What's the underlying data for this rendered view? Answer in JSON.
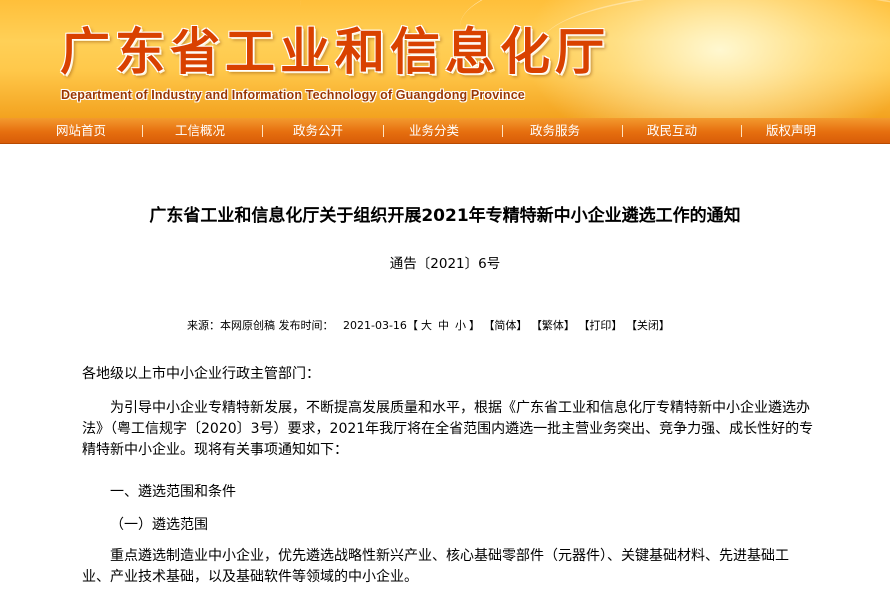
{
  "header": {
    "title_cn": "广东省工业和信息化厅",
    "title_en": "Department of Industry and Information Technology of Guangdong Province"
  },
  "nav": {
    "items": [
      "网站首页",
      "工信概况",
      "政务公开",
      "业务分类",
      "政务服务",
      "政民互动",
      "版权声明"
    ]
  },
  "article": {
    "title": "广东省工业和信息化厅关于组织开展2021年专精特新中小企业遴选工作的通知",
    "doc_number": "通告〔2021〕6号",
    "meta": {
      "source_label": "来源：",
      "source": "本网原创稿",
      "date_label": "发布时间：",
      "date": "2021-03-16",
      "font_open": "【",
      "font_large": "大",
      "font_medium": "中",
      "font_small": "小",
      "font_close": "】",
      "simplified": "【简体】",
      "traditional": "【繁体】",
      "print": "【打印】",
      "close": "【关闭】"
    },
    "salutation": "各地级以上市中小企业行政主管部门：",
    "paragraph1": "为引导中小企业专精特新发展，不断提高发展质量和水平，根据《广东省工业和信息化厅专精特新中小企业遴选办法》（粤工信规字〔2020〕3号）要求，2021年我厅将在全省范围内遴选一批主营业务突出、竞争力强、成长性好的专精特新中小企业。现将有关事项通知如下：",
    "section1": "一、遴选范围和条件",
    "subsection1": "（一）遴选范围",
    "paragraph2": "重点遴选制造业中小企业，优先遴选战略性新兴产业、核心基础零部件（元器件）、关键基础材料、先进基础工业、产业技术基础，以及基础软件等领域的中小企业。"
  },
  "colors": {
    "banner_orange": "#ffc84a",
    "title_red": "#d94100",
    "nav_orange": "#e66f0f"
  }
}
